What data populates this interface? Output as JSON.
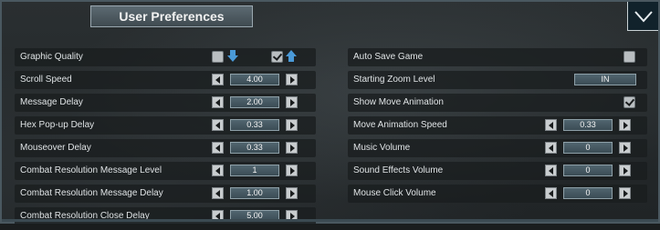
{
  "window": {
    "title": "User Preferences"
  },
  "left": [
    {
      "label": "Graphic Quality",
      "type": "quality"
    },
    {
      "label": "Scroll Speed",
      "type": "stepper",
      "value": "4.00"
    },
    {
      "label": "Message Delay",
      "type": "stepper",
      "value": "2.00"
    },
    {
      "label": "Hex Pop-up Delay",
      "type": "stepper",
      "value": "0.33"
    },
    {
      "label": "Mouseover Delay",
      "type": "stepper",
      "value": "0.33"
    },
    {
      "label": "Combat Resolution Message Level",
      "type": "stepper",
      "value": "1"
    },
    {
      "label": "Combat Resolution Message Delay",
      "type": "stepper",
      "value": "1.00"
    },
    {
      "label": "Combat Resolution Close Delay",
      "type": "stepper",
      "value": "5.00"
    }
  ],
  "right": [
    {
      "label": "Auto Save Game",
      "type": "checkbox",
      "checked": false
    },
    {
      "label": "Starting Zoom Level",
      "type": "select",
      "value": "IN"
    },
    {
      "label": "Show Move Animation",
      "type": "checkbox",
      "checked": true
    },
    {
      "label": "Move Animation Speed",
      "type": "stepper",
      "value": "0.33"
    },
    {
      "label": "Music Volume",
      "type": "stepper",
      "value": "0"
    },
    {
      "label": "Sound Effects Volume",
      "type": "stepper",
      "value": "0"
    },
    {
      "label": "Mouse Click Volume",
      "type": "stepper",
      "value": "0"
    }
  ],
  "colors": {
    "accent_blue": "#4a9ad8",
    "panel": "#1a1d1e"
  },
  "icons": {
    "close": "chevron-down-icon",
    "quality_low": "arrow-down-icon",
    "quality_high": "arrow-up-icon"
  }
}
